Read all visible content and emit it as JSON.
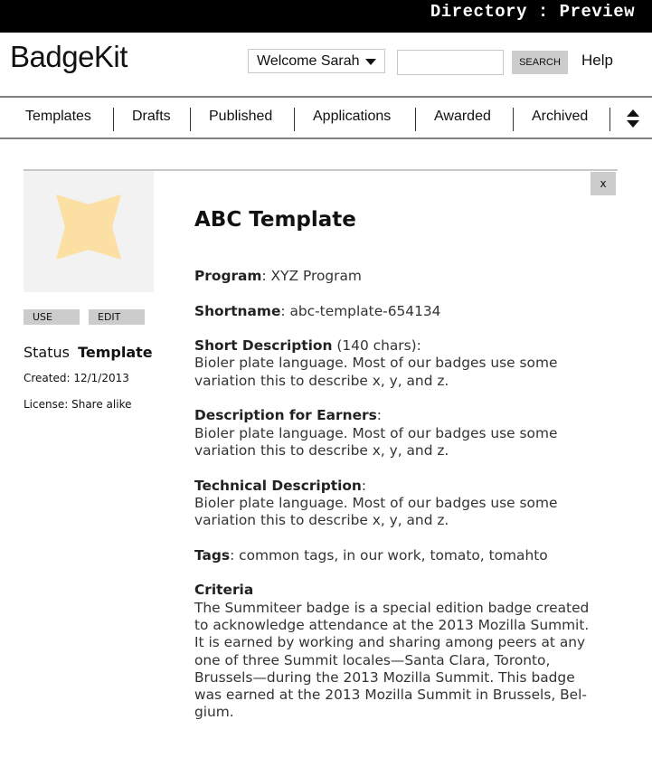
{
  "header": {
    "window_title": "Directory : Preview",
    "logo": "BadgeKit",
    "user_menu_label": "Welcome Sarah",
    "search_value": "",
    "search_button": "SEARCH",
    "help_link": "Help"
  },
  "nav": {
    "tabs": [
      {
        "label": "Templates"
      },
      {
        "label": "Drafts"
      },
      {
        "label": "Published"
      },
      {
        "label": "Applications"
      },
      {
        "label": "Awarded"
      },
      {
        "label": "Archived"
      }
    ],
    "sort_icon": "sort-up-down-icon"
  },
  "sidebar": {
    "badge_icon": "four-point-star",
    "badge_color": "#fbdfa3",
    "use_button": "USE",
    "edit_button": "EDIT",
    "status_label": "Status",
    "status_value": "Template",
    "created": "Created: 12/1/2013",
    "license": "License: Share alike"
  },
  "detail": {
    "close_button": "x",
    "title": "ABC Template",
    "program_label": "Program",
    "program_value": ": XYZ Program",
    "shortname_label": "Shortname",
    "shortname_value": ": abc-template-654134",
    "short_desc_label": "Short Description",
    "short_desc_suffix": " (140 chars):",
    "short_desc_text": "Bioler plate language. Most of our badges use some variation this to describe x, y, and z.",
    "earners_desc_label": "Description for Earners",
    "earners_desc_suffix": ":",
    "earners_desc_text": "Bioler plate language. Most of our badges use some variation this to describe x, y, and z.",
    "tech_desc_label": "Technical Description",
    "tech_desc_suffix": ":",
    "tech_desc_text": "Bioler plate language. Most of our badges use some variation this to describe x, y, and z.",
    "tags_label": "Tags",
    "tags_value": ": common tags, in our work, tomato, tomahto",
    "criteria_label": "Criteria",
    "criteria_text": "The Summiteer badge is a special edition badge created to acknowledge attendance at the 2013 Mozilla Summit. It is earned by working and sharing among peers at any one of three Summit locales—Santa Clara, Toronto, Brussels—during the 2013 Mozilla Summit. This badge was earned at the 2013 Mozilla Summit in Brussels, Bel-gium."
  }
}
